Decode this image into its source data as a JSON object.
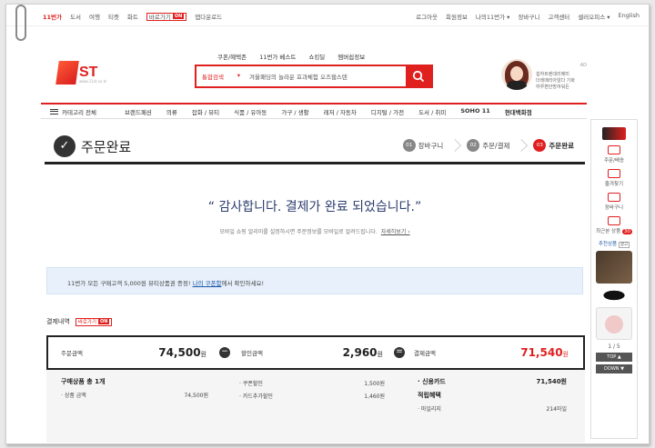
{
  "topbar": {
    "left": [
      "11번가",
      "도서",
      "여행",
      "티켓",
      "화트"
    ],
    "promo_label": "바로가기",
    "promo_badge": "ON",
    "extra": "앱다운로드",
    "right": [
      "로그아웃",
      "회원정보",
      "나의11번가 ▾",
      "장바구니",
      "고객센터",
      "셀러오피스 ▾",
      "English"
    ]
  },
  "logo": {
    "text": "ST",
    "sub": "www.11st.co.kr"
  },
  "subnav": [
    "쿠폰/혜택존",
    "11번가 베스트",
    "쇼킹딜",
    "멤버쉽정보"
  ],
  "search": {
    "category": "통합검색",
    "keyword": "겨울패딩의 놀라운 효과체험 오즈웹스텐"
  },
  "promo_text": {
    "header": "AD",
    "lines": [
      "쉽하트렌데리메미",
      "더레매리아알다 기화",
      "하루편안방여워든"
    ]
  },
  "catbar": {
    "all_label": "카테고리 전체",
    "items": [
      "브랜드패션",
      "의류",
      "잡화 / 뷰티",
      "식품 / 유아동",
      "가구 / 생활",
      "레저 / 자동차",
      "디지털 / 가전",
      "도서 / 취미",
      "SOHO 11",
      "현대백화점"
    ]
  },
  "steps": {
    "title": "주문완료",
    "flow": [
      {
        "num": "01",
        "label": "장바구니"
      },
      {
        "num": "02",
        "label": "주문/결제"
      },
      {
        "num": "03",
        "label": "주문완료"
      }
    ]
  },
  "thanks": {
    "message": "“ 감사합니다. 결제가 완료 되었습니다.”",
    "sub": "모바일 쇼핑 알리미를 설정하시면 주문정보를 모바일로 알려드립니다.",
    "link": "자세히보기 ›"
  },
  "coupon": {
    "text_before": "11번가 모든 구매고객 5,000원 뷰티상품권 증정! ",
    "link": "나의 쿠폰함",
    "text_after": "에서 확인하세요!"
  },
  "payment": {
    "header": "결제내역",
    "badge_label": "바로가기",
    "badge_on": "ON",
    "order_label": "주문금액",
    "order_value": "74,500",
    "discount_label": "할인금액",
    "discount_value": "2,960",
    "total_label": "결제금액",
    "total_value": "71,540",
    "currency": "원",
    "minus": "−",
    "equals": "="
  },
  "details": {
    "items_label": "구매상품 총 1개",
    "product_label": "· 상품 금액",
    "product_value": "74,500원",
    "coupon_label": "· 쿠폰할인",
    "coupon_value": "1,500원",
    "card_label": "· 카드추가할인",
    "card_value": "1,460원",
    "credit_label": "· 신용카드",
    "credit_value": "71,540원",
    "points_header": "적립혜택",
    "points_label": "· 마일리지",
    "points_value": "214마일"
  },
  "rail": {
    "items": [
      "주문/배송",
      "줄겨찾기",
      "장바구니",
      "최근본 상품"
    ],
    "recent_count": "30",
    "recent_label": "추천상품",
    "recent_tag": "광고",
    "pager": "1 / 5",
    "top": "TOP ▲",
    "down": "DOWN ▼"
  },
  "colors": {
    "accent": "#e0201f",
    "navy": "#2d3e6e",
    "coupon_bg": "#e8f1fb"
  }
}
